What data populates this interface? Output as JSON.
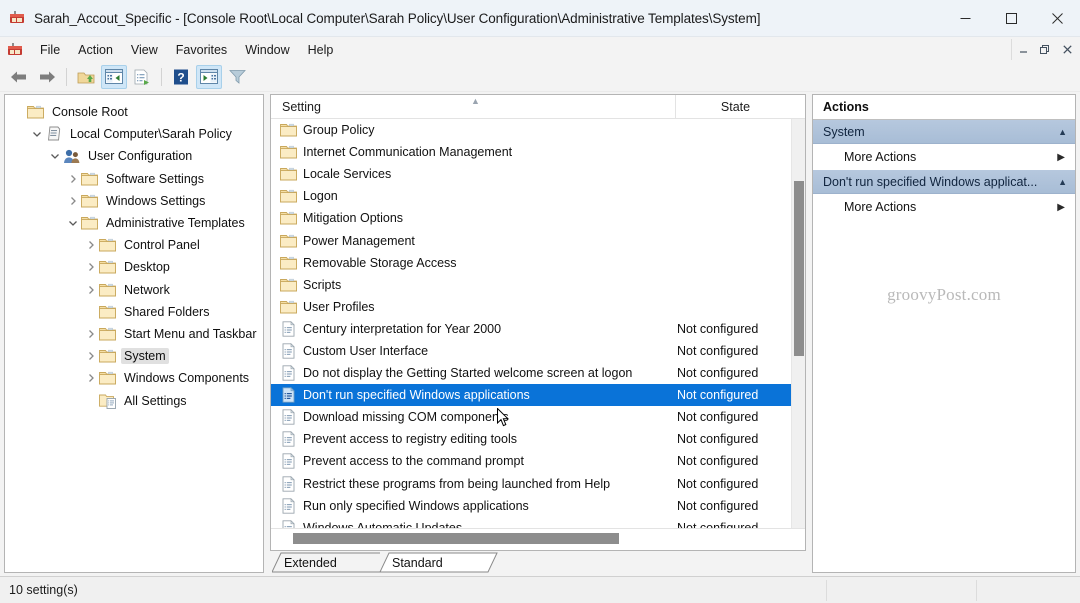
{
  "window": {
    "title": "Sarah_Accout_Specific - [Console Root\\Local Computer\\Sarah Policy\\User Configuration\\Administrative Templates\\System]",
    "app_icon": "mmc-console-icon",
    "controls": {
      "minimize": "—",
      "maximize": "□",
      "close": "✕"
    },
    "doc_controls": {
      "minimize": "–",
      "restore": "❐",
      "close": "✕"
    }
  },
  "menubar": {
    "icon": "mmc-console-icon",
    "items": [
      {
        "label": "File",
        "name": "menu-file"
      },
      {
        "label": "Action",
        "name": "menu-action"
      },
      {
        "label": "View",
        "name": "menu-view"
      },
      {
        "label": "Favorites",
        "name": "menu-favorites"
      },
      {
        "label": "Window",
        "name": "menu-window"
      },
      {
        "label": "Help",
        "name": "menu-help"
      }
    ]
  },
  "toolbar": {
    "buttons": [
      {
        "name": "back-icon",
        "tip": "Back"
      },
      {
        "name": "forward-icon",
        "tip": "Forward"
      },
      {
        "name": "up-one-level-icon",
        "tip": "Up One Level"
      },
      {
        "name": "show-hide-console-tree-icon",
        "tip": "Show/Hide Console Tree",
        "active": true
      },
      {
        "name": "export-list-icon",
        "tip": "Export List"
      },
      {
        "name": "help-icon",
        "tip": "Help"
      },
      {
        "name": "show-hide-action-pane-icon",
        "tip": "Show/Hide Action Pane",
        "active": true
      },
      {
        "name": "filter-icon",
        "tip": "Filter"
      }
    ]
  },
  "tree": {
    "items": [
      {
        "label": "Console Root",
        "depth": 0,
        "twisty": "",
        "icon": "folder-icon",
        "selected": false
      },
      {
        "label": "Local Computer\\Sarah Policy",
        "depth": 1,
        "twisty": "expanded",
        "icon": "policy-icon",
        "selected": false
      },
      {
        "label": "User Configuration",
        "depth": 2,
        "twisty": "expanded",
        "icon": "user-config-icon",
        "selected": false
      },
      {
        "label": "Software Settings",
        "depth": 3,
        "twisty": "collapsed",
        "icon": "folder-icon",
        "selected": false
      },
      {
        "label": "Windows Settings",
        "depth": 3,
        "twisty": "collapsed",
        "icon": "folder-icon",
        "selected": false
      },
      {
        "label": "Administrative Templates",
        "depth": 3,
        "twisty": "expanded",
        "icon": "folder-icon",
        "selected": false
      },
      {
        "label": "Control Panel",
        "depth": 4,
        "twisty": "collapsed",
        "icon": "folder-icon",
        "selected": false
      },
      {
        "label": "Desktop",
        "depth": 4,
        "twisty": "collapsed",
        "icon": "folder-icon",
        "selected": false
      },
      {
        "label": "Network",
        "depth": 4,
        "twisty": "collapsed",
        "icon": "folder-icon",
        "selected": false
      },
      {
        "label": "Shared Folders",
        "depth": 4,
        "twisty": "",
        "icon": "folder-icon",
        "selected": false
      },
      {
        "label": "Start Menu and Taskbar",
        "depth": 4,
        "twisty": "collapsed",
        "icon": "folder-icon",
        "selected": false
      },
      {
        "label": "System",
        "depth": 4,
        "twisty": "collapsed",
        "icon": "folder-icon",
        "selected": true
      },
      {
        "label": "Windows Components",
        "depth": 4,
        "twisty": "collapsed",
        "icon": "folder-icon",
        "selected": false
      },
      {
        "label": "All Settings",
        "depth": 4,
        "twisty": "",
        "icon": "all-settings-icon",
        "selected": false
      }
    ]
  },
  "list": {
    "columns": [
      {
        "label": "Setting",
        "name": "column-header-setting",
        "sorted": true
      },
      {
        "label": "State",
        "name": "column-header-state",
        "sorted": false
      }
    ],
    "rows": [
      {
        "label": "Group Policy",
        "state": "",
        "icon": "folder-icon",
        "selected": false
      },
      {
        "label": "Internet Communication Management",
        "state": "",
        "icon": "folder-icon",
        "selected": false
      },
      {
        "label": "Locale Services",
        "state": "",
        "icon": "folder-icon",
        "selected": false
      },
      {
        "label": "Logon",
        "state": "",
        "icon": "folder-icon",
        "selected": false
      },
      {
        "label": "Mitigation Options",
        "state": "",
        "icon": "folder-icon",
        "selected": false
      },
      {
        "label": "Power Management",
        "state": "",
        "icon": "folder-icon",
        "selected": false
      },
      {
        "label": "Removable Storage Access",
        "state": "",
        "icon": "folder-icon",
        "selected": false
      },
      {
        "label": "Scripts",
        "state": "",
        "icon": "folder-icon",
        "selected": false
      },
      {
        "label": "User Profiles",
        "state": "",
        "icon": "folder-icon",
        "selected": false
      },
      {
        "label": "Century interpretation for Year 2000",
        "state": "Not configured",
        "icon": "policy-setting-icon",
        "selected": false
      },
      {
        "label": "Custom User Interface",
        "state": "Not configured",
        "icon": "policy-setting-icon",
        "selected": false
      },
      {
        "label": "Do not display the Getting Started welcome screen at logon",
        "state": "Not configured",
        "icon": "policy-setting-icon",
        "selected": false
      },
      {
        "label": "Don't run specified Windows applications",
        "state": "Not configured",
        "icon": "policy-setting-icon",
        "selected": true
      },
      {
        "label": "Download missing COM components",
        "state": "Not configured",
        "icon": "policy-setting-icon",
        "selected": false
      },
      {
        "label": "Prevent access to registry editing tools",
        "state": "Not configured",
        "icon": "policy-setting-icon",
        "selected": false
      },
      {
        "label": "Prevent access to the command prompt",
        "state": "Not configured",
        "icon": "policy-setting-icon",
        "selected": false
      },
      {
        "label": "Restrict these programs from being launched from Help",
        "state": "Not configured",
        "icon": "policy-setting-icon",
        "selected": false
      },
      {
        "label": "Run only specified Windows applications",
        "state": "Not configured",
        "icon": "policy-setting-icon",
        "selected": false
      },
      {
        "label": "Windows Automatic Updates",
        "state": "Not configured",
        "icon": "policy-setting-icon",
        "selected": false
      }
    ]
  },
  "tabs": [
    {
      "label": "Extended",
      "active": false,
      "name": "tab-extended"
    },
    {
      "label": "Standard",
      "active": true,
      "name": "tab-standard"
    }
  ],
  "actions": {
    "title": "Actions",
    "groups": [
      {
        "title": "System",
        "name": "actions-group-system",
        "collapse_glyph": "▲",
        "items": [
          {
            "label": "More Actions",
            "arrow": "▶",
            "name": "more-actions-system"
          }
        ]
      },
      {
        "title": "Don't run specified Windows applicat...",
        "name": "actions-group-policy",
        "collapse_glyph": "▲",
        "items": [
          {
            "label": "More Actions",
            "arrow": "▶",
            "name": "more-actions-policy"
          }
        ]
      }
    ],
    "watermark": "groovyPost.com"
  },
  "statusbar": {
    "text": "10 setting(s)"
  },
  "colors": {
    "selection": "#0a73d8",
    "actions_group_header": "#aec2da",
    "titlebar": "#eef3f8",
    "chrome": "#f3f3f3"
  }
}
